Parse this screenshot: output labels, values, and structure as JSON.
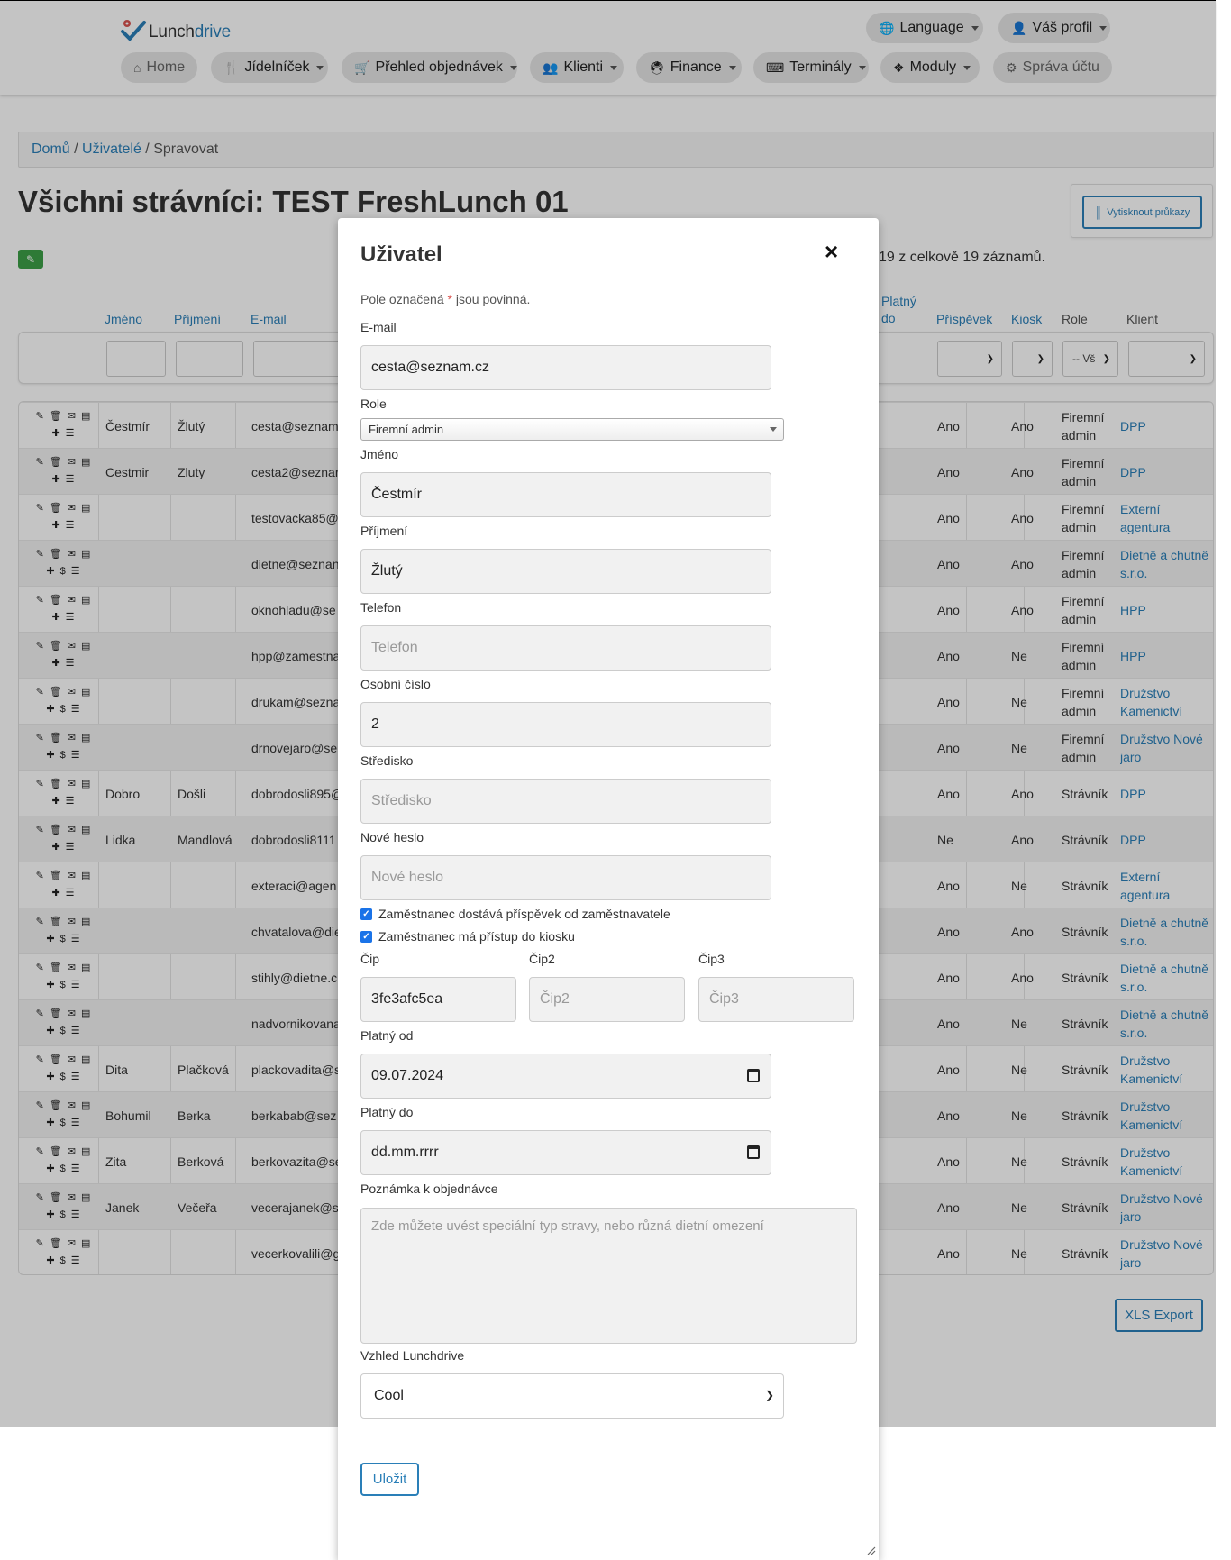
{
  "nav": {
    "logo_text_1": "Lunch",
    "logo_text_2": "drive",
    "language": "Language",
    "profile": "Váš profil",
    "items": [
      "Home",
      "Jídelníček",
      "Přehled objednávek",
      "Klienti",
      "Finance",
      "Terminály",
      "Moduly",
      "Správa účtu"
    ]
  },
  "breadcrumb": {
    "home": "Domů",
    "users": "Uživatelé",
    "current": "Spravovat",
    "sep": " / "
  },
  "page": {
    "title": "Všichni strávníci: TEST FreshLunch 01",
    "print_button": "Vytisknout průkazy",
    "records_info": "19 z celkově 19 záznamů.",
    "xls_export": "XLS Export"
  },
  "table": {
    "headers": {
      "first": "Jméno",
      "last": "Příjmení",
      "email": "E-mail",
      "valid_to": "Platný do",
      "contribution": "Příspěvek",
      "kiosk": "Kiosk",
      "role": "Role",
      "client": "Klient"
    },
    "role_filter": "-- Vš",
    "rows": [
      {
        "first": "Čestmír",
        "last": "Žlutý",
        "email": "cesta@seznam",
        "contrib": "Ano",
        "kiosk": "Ano",
        "role": "Firemní admin",
        "client": "DPP",
        "dollar": false
      },
      {
        "first": "Cestmir",
        "last": "Zluty",
        "email": "cesta2@seznar",
        "contrib": "Ano",
        "kiosk": "Ano",
        "role": "Firemní admin",
        "client": "DPP",
        "dollar": false
      },
      {
        "first": "",
        "last": "",
        "email": "testovacka85@",
        "contrib": "Ano",
        "kiosk": "Ano",
        "role": "Firemní admin",
        "client": "Externí agentura",
        "dollar": false
      },
      {
        "first": "",
        "last": "",
        "email": "dietne@seznan",
        "contrib": "Ano",
        "kiosk": "Ano",
        "role": "Firemní admin",
        "client": "Dietně a chutně s.r.o.",
        "dollar": true
      },
      {
        "first": "",
        "last": "",
        "email": "oknohladu@se",
        "contrib": "Ano",
        "kiosk": "Ano",
        "role": "Firemní admin",
        "client": "HPP",
        "dollar": false
      },
      {
        "first": "",
        "last": "",
        "email": "hpp@zamestna",
        "contrib": "Ano",
        "kiosk": "Ne",
        "role": "Firemní admin",
        "client": "HPP",
        "dollar": false
      },
      {
        "first": "",
        "last": "",
        "email": "drukam@sezna",
        "contrib": "Ano",
        "kiosk": "Ne",
        "role": "Firemní admin",
        "client": "Družstvo Kamenictví",
        "dollar": true
      },
      {
        "first": "",
        "last": "",
        "email": "drnovejaro@se",
        "contrib": "Ano",
        "kiosk": "Ne",
        "role": "Firemní admin",
        "client": "Družstvo Nové jaro",
        "dollar": true
      },
      {
        "first": "Dobro",
        "last": "Došli",
        "email": "dobrodosli895@",
        "contrib": "Ano",
        "kiosk": "Ano",
        "role": "Strávník",
        "client": "DPP",
        "dollar": false
      },
      {
        "first": "Lidka",
        "last": "Mandlová",
        "email": "dobrodosli8111",
        "contrib": "Ne",
        "kiosk": "Ano",
        "role": "Strávník",
        "client": "DPP",
        "dollar": false
      },
      {
        "first": "",
        "last": "",
        "email": "exteraci@agen",
        "contrib": "Ano",
        "kiosk": "Ne",
        "role": "Strávník",
        "client": "Externí agentura",
        "dollar": false
      },
      {
        "first": "",
        "last": "",
        "email": "chvatalova@die",
        "contrib": "Ano",
        "kiosk": "Ano",
        "role": "Strávník",
        "client": "Dietně a chutně s.r.o.",
        "dollar": true
      },
      {
        "first": "",
        "last": "",
        "email": "stihly@dietne.c",
        "contrib": "Ano",
        "kiosk": "Ano",
        "role": "Strávník",
        "client": "Dietně a chutně s.r.o.",
        "dollar": true
      },
      {
        "first": "",
        "last": "",
        "email": "nadvornikovana",
        "contrib": "Ano",
        "kiosk": "Ne",
        "role": "Strávník",
        "client": "Dietně a chutně s.r.o.",
        "dollar": true
      },
      {
        "first": "Dita",
        "last": "Plačková",
        "email": "plackovadita@s",
        "contrib": "Ano",
        "kiosk": "Ne",
        "role": "Strávník",
        "client": "Družstvo Kamenictví",
        "dollar": true
      },
      {
        "first": "Bohumil",
        "last": "Berka",
        "email": "berkabab@sez",
        "contrib": "Ano",
        "kiosk": "Ne",
        "role": "Strávník",
        "client": "Družstvo Kamenictví",
        "dollar": true
      },
      {
        "first": "Zita",
        "last": "Berková",
        "email": "berkovazita@se",
        "contrib": "Ano",
        "kiosk": "Ne",
        "role": "Strávník",
        "client": "Družstvo Kamenictví",
        "dollar": true
      },
      {
        "first": "Janek",
        "last": "Večeřa",
        "email": "vecerajanek@s",
        "contrib": "Ano",
        "kiosk": "Ne",
        "role": "Strávník",
        "client": "Družstvo Nové jaro",
        "dollar": true
      },
      {
        "first": "",
        "last": "",
        "email": "vecerkovalili@g",
        "contrib": "Ano",
        "kiosk": "Ne",
        "role": "Strávník",
        "client": "Družstvo Nové jaro",
        "dollar": true
      }
    ]
  },
  "modal": {
    "title": "Uživatel",
    "close": "×",
    "required_note_1": "Pole označená ",
    "required_star": "*",
    "required_note_2": " jsou povinná.",
    "email_label": "E-mail",
    "email_value": "cesta@seznam.cz",
    "role_label": "Role",
    "role_value": "Firemní admin",
    "first_label": "Jméno",
    "first_value": "Čestmír",
    "last_label": "Příjmení",
    "last_value": "Žlutý",
    "phone_label": "Telefon",
    "phone_placeholder": "Telefon",
    "personal_label": "Osobní číslo",
    "personal_value": "2",
    "center_label": "Středisko",
    "center_placeholder": "Středisko",
    "password_label": "Nové heslo",
    "password_placeholder": "Nové heslo",
    "check_contribution": "Zaměstnanec dostává příspěvek od zaměstnavatele",
    "check_kiosk": "Zaměstnanec má přístup do kiosku",
    "chip_label": "Čip",
    "chip_value": "3fe3afc5ea",
    "chip2_label": "Čip2",
    "chip2_placeholder": "Čip2",
    "chip3_label": "Čip3",
    "chip3_placeholder": "Čip3",
    "valid_from_label": "Platný od",
    "valid_from_value": "09.07.2024",
    "valid_to_label": "Platný do",
    "valid_to_value": "dd.mm.rrrr",
    "note_label": "Poznámka k objednávce",
    "note_placeholder": "Zde můžete uvést speciální typ stravy, nebo různá dietní omezení",
    "theme_label": "Vzhled Lunchdrive",
    "theme_value": "Cool",
    "save": "Uložit"
  }
}
